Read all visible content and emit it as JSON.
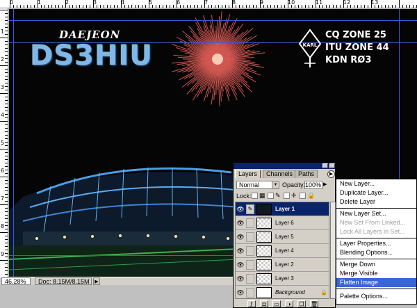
{
  "canvas": {
    "city": "DAEJEON",
    "callsign": "DS3HIU",
    "zone_lines": [
      "CQ ZONE 25",
      "ITU ZONE 44",
      "KDN RØ3"
    ],
    "logo_text": "KARL"
  },
  "rulers": {
    "top_numbers": [
      "0",
      "1",
      "2",
      "3",
      "4",
      "5",
      "6",
      "7",
      "8",
      "9",
      "10",
      "11",
      "12",
      "13"
    ],
    "left_numbers": [
      "1",
      "2",
      "3",
      "4",
      "5",
      "6",
      "7",
      "8",
      "9"
    ]
  },
  "statusbar": {
    "zoom": "46.28%",
    "doc": "Doc: 8.15M/8.15M",
    "arrow": "▶"
  },
  "palette": {
    "tabs": [
      "Layers",
      "Channels",
      "Paths"
    ],
    "menu_arrow": "▶",
    "blend_mode": "Normal",
    "opacity_label": "Opacity:",
    "opacity_value": "100%",
    "lock_label": "Lock:",
    "layers": [
      {
        "name": "Layer 1",
        "selected": true
      },
      {
        "name": "Layer 6",
        "selected": false
      },
      {
        "name": "Layer 5",
        "selected": false
      },
      {
        "name": "Layer 4",
        "selected": false
      },
      {
        "name": "Layer 2",
        "selected": false
      },
      {
        "name": "Layer 3",
        "selected": false
      },
      {
        "name": "Background",
        "selected": false
      }
    ]
  },
  "menu": {
    "items": [
      {
        "label": "New Layer...",
        "disabled": false
      },
      {
        "label": "Duplicate Layer...",
        "disabled": false
      },
      {
        "label": "Delete Layer",
        "disabled": false
      },
      {
        "label": "New Layer Set...",
        "disabled": false
      },
      {
        "label": "New Set From Linked...",
        "disabled": true
      },
      {
        "label": "Lock All Layers in Set...",
        "disabled": true
      },
      {
        "label": "Layer Properties...",
        "disabled": false
      },
      {
        "label": "Blending Options...",
        "disabled": false
      },
      {
        "label": "Merge Down",
        "disabled": false
      },
      {
        "label": "Merge Visible",
        "disabled": false
      },
      {
        "label": "Flatten Image",
        "disabled": false,
        "highlighted": true
      },
      {
        "label": "Palette Options...",
        "disabled": false
      }
    ]
  },
  "colors": {
    "guide": "#3a5ad8",
    "selection": "#0a246a",
    "menu_highlight": "#3a64d8",
    "callsign": "#7fb8e8"
  }
}
